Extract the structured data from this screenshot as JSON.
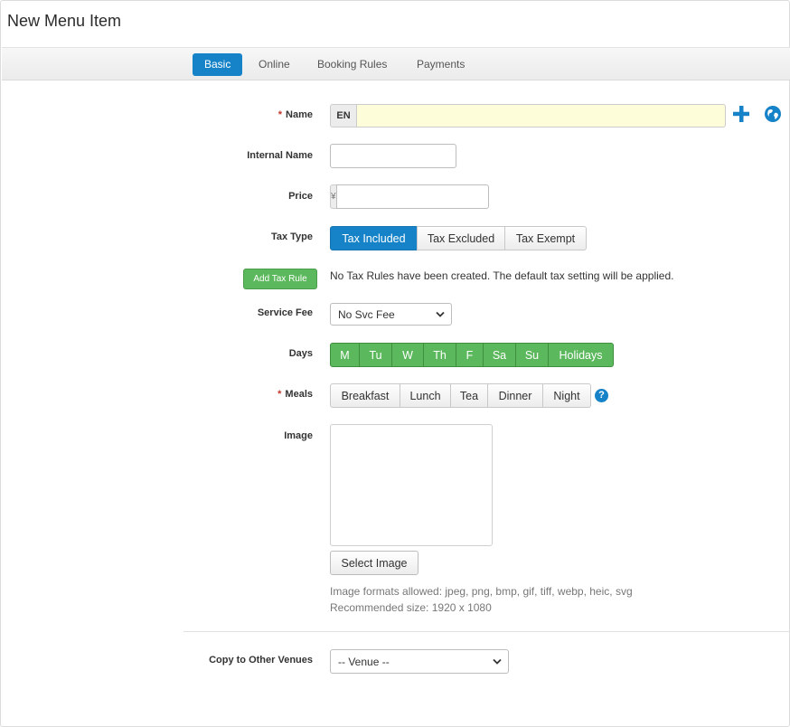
{
  "page": {
    "title": "New Menu Item"
  },
  "tabs": [
    {
      "label": "Basic",
      "active": true
    },
    {
      "label": "Online",
      "active": false
    },
    {
      "label": "Booking Rules",
      "active": false
    },
    {
      "label": "Payments",
      "active": false
    }
  ],
  "form": {
    "name": {
      "label": "Name",
      "required_mark": "*",
      "lang_addon": "EN",
      "value": ""
    },
    "internal_name": {
      "label": "Internal Name",
      "value": ""
    },
    "price": {
      "label": "Price",
      "currency": "¥",
      "value": ""
    },
    "tax_type": {
      "label": "Tax Type",
      "options": [
        "Tax Included",
        "Tax Excluded",
        "Tax Exempt"
      ],
      "selected": "Tax Included"
    },
    "tax_rule": {
      "button": "Add Tax Rule",
      "message": "No Tax Rules have been created. The default tax setting will be applied."
    },
    "service_fee": {
      "label": "Service Fee",
      "selected": "No Svc Fee"
    },
    "days": {
      "label": "Days",
      "options": [
        "M",
        "Tu",
        "W",
        "Th",
        "F",
        "Sa",
        "Su",
        "Holidays"
      ],
      "all_selected": true
    },
    "meals": {
      "label": "Meals",
      "required_mark": "*",
      "options": [
        "Breakfast",
        "Lunch",
        "Tea",
        "Dinner",
        "Night"
      ],
      "help": "?"
    },
    "image": {
      "label": "Image",
      "button": "Select Image",
      "formats_hint": "Image formats allowed: jpeg, png, bmp, gif, tiff, webp, heic, svg",
      "size_hint": "Recommended size: 1920 x 1080"
    },
    "copy_venues": {
      "label": "Copy to Other Venues",
      "selected": "-- Venue --"
    }
  },
  "colors": {
    "primary": "#1683c8",
    "success": "#5cb85c",
    "name_field_bg": "#fdfdd9",
    "required": "#c0392b"
  },
  "icons": {
    "add": "plus-icon",
    "translate": "globe-icon",
    "help": "question-circle-icon",
    "select_arrow": "chevron-down-icon"
  }
}
